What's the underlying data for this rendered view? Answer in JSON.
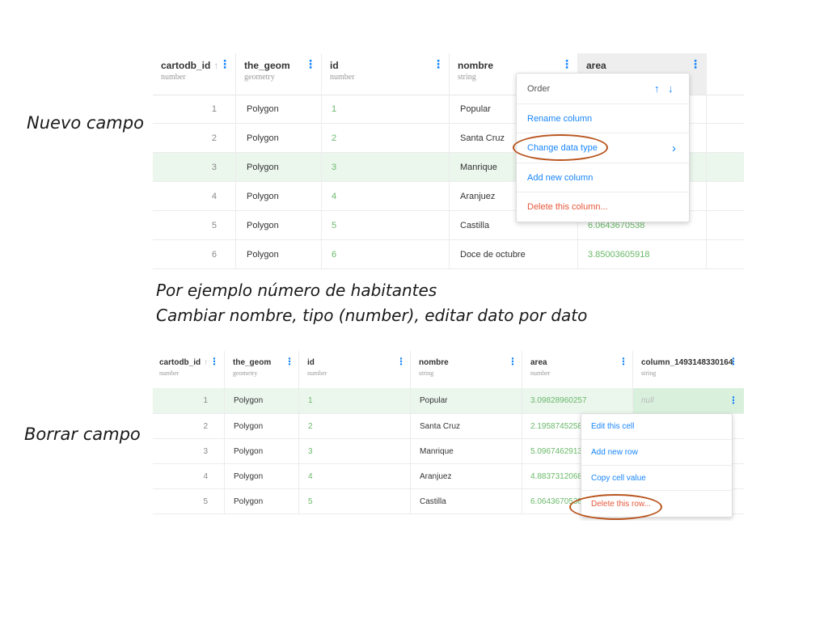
{
  "captions": {
    "nuevo": "Nuevo campo",
    "borrar": "Borrar campo",
    "note1": "Por ejemplo número de habitantes",
    "note2": "Cambiar nombre, tipo (number), editar dato por dato"
  },
  "table1": {
    "columns": [
      {
        "name": "cartodb_id",
        "type": "number"
      },
      {
        "name": "the_geom",
        "type": "geometry"
      },
      {
        "name": "id",
        "type": "number"
      },
      {
        "name": "nombre",
        "type": "string"
      },
      {
        "name": "area",
        "type": ""
      }
    ],
    "sort_icon": "↑",
    "kebab": "⋮",
    "rows": [
      {
        "cartodb_id": "1",
        "geom": "Polygon",
        "id": "1",
        "nombre": "Popular",
        "area": ""
      },
      {
        "cartodb_id": "2",
        "geom": "Polygon",
        "id": "2",
        "nombre": "Santa Cruz",
        "area": ""
      },
      {
        "cartodb_id": "3",
        "geom": "Polygon",
        "id": "3",
        "nombre": "Manrique",
        "area": ""
      },
      {
        "cartodb_id": "4",
        "geom": "Polygon",
        "id": "4",
        "nombre": "Aranjuez",
        "area": ""
      },
      {
        "cartodb_id": "5",
        "geom": "Polygon",
        "id": "5",
        "nombre": "Castilla",
        "area": "6.0643670538"
      },
      {
        "cartodb_id": "6",
        "geom": "Polygon",
        "id": "6",
        "nombre": "Doce de octubre",
        "area": "3.85003605918"
      }
    ],
    "menu": {
      "order": "Order",
      "order_up": "↑",
      "order_down": "↓",
      "rename": "Rename column",
      "change_type": "Change data type",
      "change_type_chevron": "›",
      "add_column": "Add new column",
      "delete_column": "Delete this column..."
    }
  },
  "table2": {
    "columns": [
      {
        "name": "cartodb_id",
        "type": "number"
      },
      {
        "name": "the_geom",
        "type": "geometry"
      },
      {
        "name": "id",
        "type": "number"
      },
      {
        "name": "nombre",
        "type": "string"
      },
      {
        "name": "area",
        "type": "number"
      },
      {
        "name": "column_1493148330164",
        "type": "string"
      }
    ],
    "sort_icon": "↑",
    "kebab": "⋮",
    "rows": [
      {
        "cartodb_id": "1",
        "geom": "Polygon",
        "id": "1",
        "nombre": "Popular",
        "area": "3.09828960257",
        "col": "null"
      },
      {
        "cartodb_id": "2",
        "geom": "Polygon",
        "id": "2",
        "nombre": "Santa Cruz",
        "area": "2.1958745258",
        "col": ""
      },
      {
        "cartodb_id": "3",
        "geom": "Polygon",
        "id": "3",
        "nombre": "Manrique",
        "area": "5.0967462913",
        "col": ""
      },
      {
        "cartodb_id": "4",
        "geom": "Polygon",
        "id": "4",
        "nombre": "Aranjuez",
        "area": "4.8837312068",
        "col": ""
      },
      {
        "cartodb_id": "5",
        "geom": "Polygon",
        "id": "5",
        "nombre": "Castilla",
        "area": "6.0643670538",
        "col": ""
      }
    ],
    "menu": {
      "edit_cell": "Edit this cell",
      "add_row": "Add new row",
      "copy_value": "Copy cell value",
      "delete_row": "Delete this row..."
    }
  },
  "colors": {
    "accent": "#1785fb",
    "numeric": "#6ab96a",
    "danger": "#e5583b",
    "highlight_ring": "#b8551e",
    "selected_row": "#ebf6ed"
  }
}
